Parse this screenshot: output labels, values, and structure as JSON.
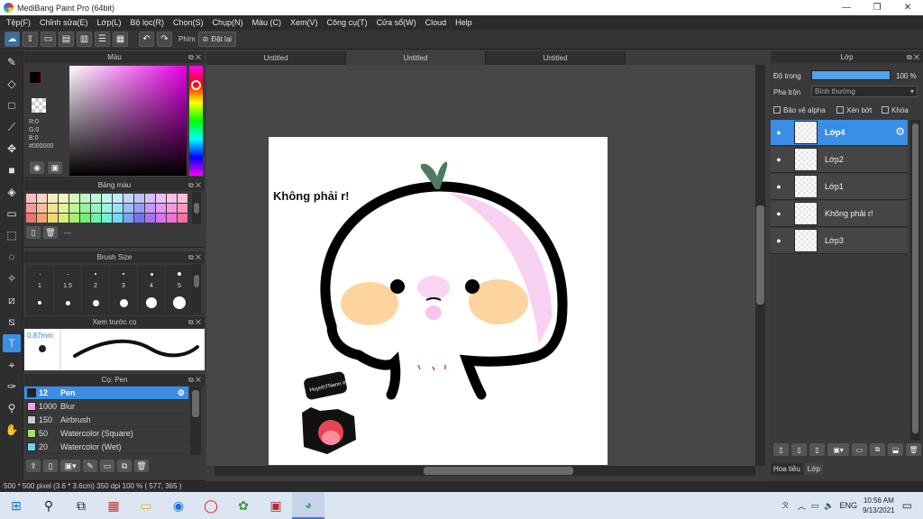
{
  "window": {
    "title": "MediBang Paint Pro (64bit)",
    "minimize": "—",
    "maximize": "❐",
    "close": "✕"
  },
  "menu": [
    "Tệp(F)",
    "Chỉnh sửa(E)",
    "Lớp(L)",
    "Bộ lọc(R)",
    "Chọn(S)",
    "Chụp(N)",
    "Màu (C)",
    "Xem(V)",
    "Công cụ(T)",
    "Cửa sổ(W)",
    "Cloud",
    "Help"
  ],
  "toolbar": {
    "keys_label": "Phím",
    "reset_label": "Đặt lại"
  },
  "color_panel": {
    "title": "Màu",
    "r": "R:0",
    "g": "G:0",
    "b": "B:0",
    "hex": "#000000",
    "accent": "#e600e6"
  },
  "palette_panel": {
    "title": "Bảng màu",
    "name": "---",
    "colors": [
      "#f6c1c1",
      "#f6d7c1",
      "#f6ecc1",
      "#ecf6c1",
      "#d7f6c1",
      "#c1f6c1",
      "#c1f6d7",
      "#c1f6ec",
      "#c1ecf6",
      "#c1d7f6",
      "#c1c1f6",
      "#d7c1f6",
      "#ecc1f6",
      "#f6c1ec",
      "#f6c1d7",
      "#f39a9a",
      "#f3be9a",
      "#f3e29a",
      "#e2f39a",
      "#bef39a",
      "#9af39a",
      "#9af3be",
      "#9af3e2",
      "#9ae2f3",
      "#9abef3",
      "#9a9af3",
      "#be9af3",
      "#e29af3",
      "#f39ae2",
      "#f39abe",
      "#ef7272",
      "#efa472",
      "#efd972",
      "#d9ef72",
      "#a4ef72",
      "#72ef72",
      "#72efa4",
      "#72efd9",
      "#72d9ef",
      "#72a4ef",
      "#7272ef",
      "#a472ef",
      "#d972ef",
      "#ef72d9",
      "#ef72a4"
    ]
  },
  "brush_size_panel": {
    "title": "Brush Size",
    "sizes": [
      "1",
      "1.5",
      "2",
      "3",
      "4",
      "5"
    ]
  },
  "brush_preview_panel": {
    "title": "Xem trước cọ",
    "size": "0.87mm"
  },
  "brush_list_panel": {
    "title": "Cọ: Pen",
    "brushes": [
      {
        "size": "12",
        "name": "Pen",
        "color": "#222222"
      },
      {
        "size": "1000",
        "name": "Blur",
        "color": "#f0a0f0"
      },
      {
        "size": "150",
        "name": "Airbrush",
        "color": "#cccccc"
      },
      {
        "size": "50",
        "name": "Watercolor (Square)",
        "color": "#a8e070"
      },
      {
        "size": "20",
        "name": "Watercolor (Wet)",
        "color": "#70d0f0"
      }
    ]
  },
  "tabs": [
    "Untitled",
    "Untitled",
    "Untitled"
  ],
  "canvas": {
    "text": "Không phải r!",
    "sticker_text": "HuynhThienn #Hoidap247"
  },
  "status": "500 * 500 pixel  (3.6 * 3.6cm)  350 dpi  100 %  ( 577, 365 )",
  "layers_panel": {
    "title": "Lớp",
    "opacity_label": "Độ trong",
    "opacity_value": "100 %",
    "opacity": 1.0,
    "blend_label": "Pha trộn",
    "blend_value": "Bình thường",
    "protect_alpha": "Bảo vệ alpha",
    "clipping": "Xén bớt",
    "lock": "Khóa",
    "layers": [
      {
        "name": "Lớp4",
        "selected": true
      },
      {
        "name": "Lớp2",
        "selected": false
      },
      {
        "name": "Lớp1",
        "selected": false
      },
      {
        "name": "Không phải r!",
        "selected": false
      },
      {
        "name": "Lớp3",
        "selected": false
      }
    ],
    "tab_navigator": "Hoa tiêu",
    "tab_layers": "Lớp"
  },
  "taskbar": {
    "lang": "ENG",
    "time": "10:56 AM",
    "date": "9/13/2021"
  }
}
